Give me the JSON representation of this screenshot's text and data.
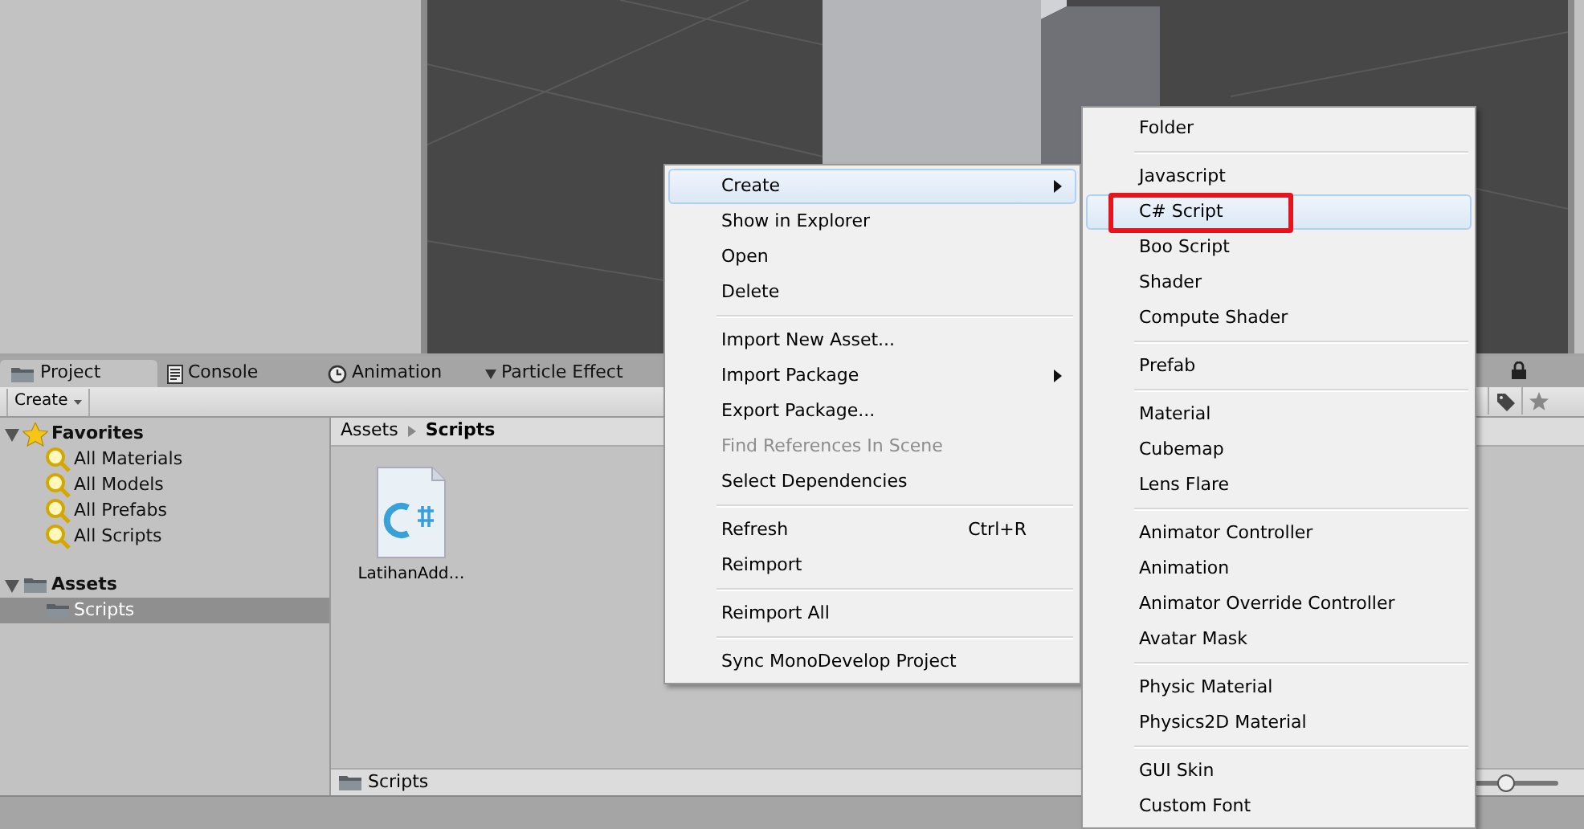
{
  "scene_view": {
    "kind": "picture"
  },
  "tabs": [
    {
      "label": "Project",
      "selected": true
    },
    {
      "label": "Console",
      "selected": false
    },
    {
      "label": "Animation",
      "selected": false
    },
    {
      "label": "Particle Effect",
      "selected": false
    }
  ],
  "toolbar": {
    "create_button": "Create"
  },
  "tree": [
    {
      "label": "Favorites",
      "expanded": true,
      "selected": false,
      "children": [
        {
          "label": "All Materials",
          "selected": false
        },
        {
          "label": "All Models",
          "selected": false
        },
        {
          "label": "All Prefabs",
          "selected": false
        },
        {
          "label": "All Scripts",
          "selected": false
        }
      ]
    },
    {
      "label": "Assets",
      "expanded": true,
      "selected": false,
      "children": [
        {
          "label": "Scripts",
          "selected": true
        }
      ]
    }
  ],
  "breadcrumb": [
    "Assets",
    "Scripts"
  ],
  "assets": [
    {
      "name": "LatihanAdd…",
      "kind": "csharp"
    }
  ],
  "footer_path": "Scripts",
  "icon_size_slider": {
    "level": 0.45
  },
  "context_menu": {
    "groups": [
      [
        {
          "label": "Create",
          "submenu": true,
          "selected": true,
          "disabled": false
        },
        {
          "label": "Show in Explorer",
          "submenu": false,
          "selected": false,
          "disabled": false
        },
        {
          "label": "Open",
          "submenu": false,
          "selected": false,
          "disabled": false
        },
        {
          "label": "Delete",
          "submenu": false,
          "selected": false,
          "disabled": false
        }
      ],
      [
        {
          "label": "Import New Asset...",
          "submenu": false,
          "selected": false,
          "disabled": false
        },
        {
          "label": "Import Package",
          "submenu": true,
          "selected": false,
          "disabled": false
        },
        {
          "label": "Export Package...",
          "submenu": false,
          "selected": false,
          "disabled": false
        },
        {
          "label": "Find References In Scene",
          "submenu": false,
          "selected": false,
          "disabled": true
        },
        {
          "label": "Select Dependencies",
          "submenu": false,
          "selected": false,
          "disabled": false
        }
      ],
      [
        {
          "label": "Refresh",
          "shortcut": "Ctrl+R",
          "submenu": false,
          "selected": false,
          "disabled": false
        },
        {
          "label": "Reimport",
          "submenu": false,
          "selected": false,
          "disabled": false
        }
      ],
      [
        {
          "label": "Reimport All",
          "submenu": false,
          "selected": false,
          "disabled": false
        }
      ],
      [
        {
          "label": "Sync MonoDevelop Project",
          "submenu": false,
          "selected": false,
          "disabled": false
        }
      ]
    ]
  },
  "create_submenu": {
    "groups": [
      [
        {
          "label": "Folder",
          "selected": false,
          "marked": false
        }
      ],
      [
        {
          "label": "Javascript",
          "selected": false,
          "marked": false
        },
        {
          "label": "C# Script",
          "selected": true,
          "marked": true
        },
        {
          "label": "Boo Script",
          "selected": false,
          "marked": false
        },
        {
          "label": "Shader",
          "selected": false,
          "marked": false
        },
        {
          "label": "Compute Shader",
          "selected": false,
          "marked": false
        }
      ],
      [
        {
          "label": "Prefab",
          "selected": false,
          "marked": false
        }
      ],
      [
        {
          "label": "Material",
          "selected": false,
          "marked": false
        },
        {
          "label": "Cubemap",
          "selected": false,
          "marked": false
        },
        {
          "label": "Lens Flare",
          "selected": false,
          "marked": false
        }
      ],
      [
        {
          "label": "Animator Controller",
          "selected": false,
          "marked": false
        },
        {
          "label": "Animation",
          "selected": false,
          "marked": false
        },
        {
          "label": "Animator Override Controller",
          "selected": false,
          "marked": false
        },
        {
          "label": "Avatar Mask",
          "selected": false,
          "marked": false
        }
      ],
      [
        {
          "label": "Physic Material",
          "selected": false,
          "marked": false
        },
        {
          "label": "Physics2D Material",
          "selected": false,
          "marked": false
        }
      ],
      [
        {
          "label": "GUI Skin",
          "selected": false,
          "marked": false
        },
        {
          "label": "Custom Font",
          "selected": false,
          "marked": false
        }
      ]
    ]
  }
}
